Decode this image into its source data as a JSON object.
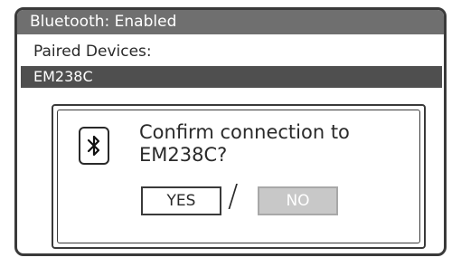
{
  "header": {
    "title": "Bluetooth: Enabled"
  },
  "paired": {
    "label": "Paired Devices:",
    "devices": [
      "EM238C"
    ]
  },
  "dialog": {
    "icon": "bluetooth-icon",
    "prompt_line1": "Confirm connection to",
    "prompt_line2": "EM238C?",
    "yes_label": "YES",
    "separator": "/",
    "no_label": "NO"
  },
  "colors": {
    "title_bar": "#6f6f6f",
    "selected_row": "#4f4f4f",
    "disabled_button": "#c8c8c8"
  }
}
